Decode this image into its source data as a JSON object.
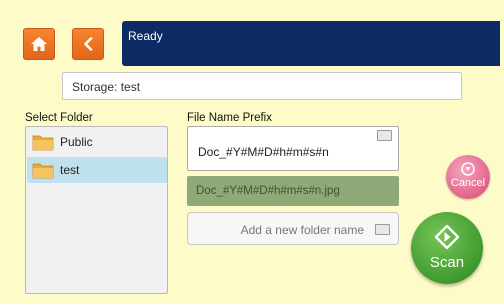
{
  "header": {
    "home_icon": "home-icon",
    "back_icon": "chevron-left-icon",
    "status": "Ready"
  },
  "storage": {
    "label": "Storage: test"
  },
  "folders": {
    "title": "Select Folder",
    "items": [
      {
        "name": "Public",
        "icon": "folder-icon",
        "selected": false
      },
      {
        "name": "test",
        "icon": "folder-icon",
        "selected": true
      }
    ]
  },
  "file_name": {
    "title": "File Name Prefix",
    "value": "Doc_#Y#M#D#h#m#s#n",
    "preview": "Doc_#Y#M#D#h#m#s#n.jpg"
  },
  "new_folder": {
    "placeholder": "Add a new folder name"
  },
  "buttons": {
    "cancel": "Cancel",
    "scan": "Scan"
  },
  "colors": {
    "background": "#fdfbc8",
    "status_bar": "#0d2b63",
    "nav_button": "#f07a26",
    "cancel": "#e2638a",
    "scan": "#3f9a2c",
    "selected_folder": "#bfe1ed",
    "preview": "#8daa78"
  }
}
